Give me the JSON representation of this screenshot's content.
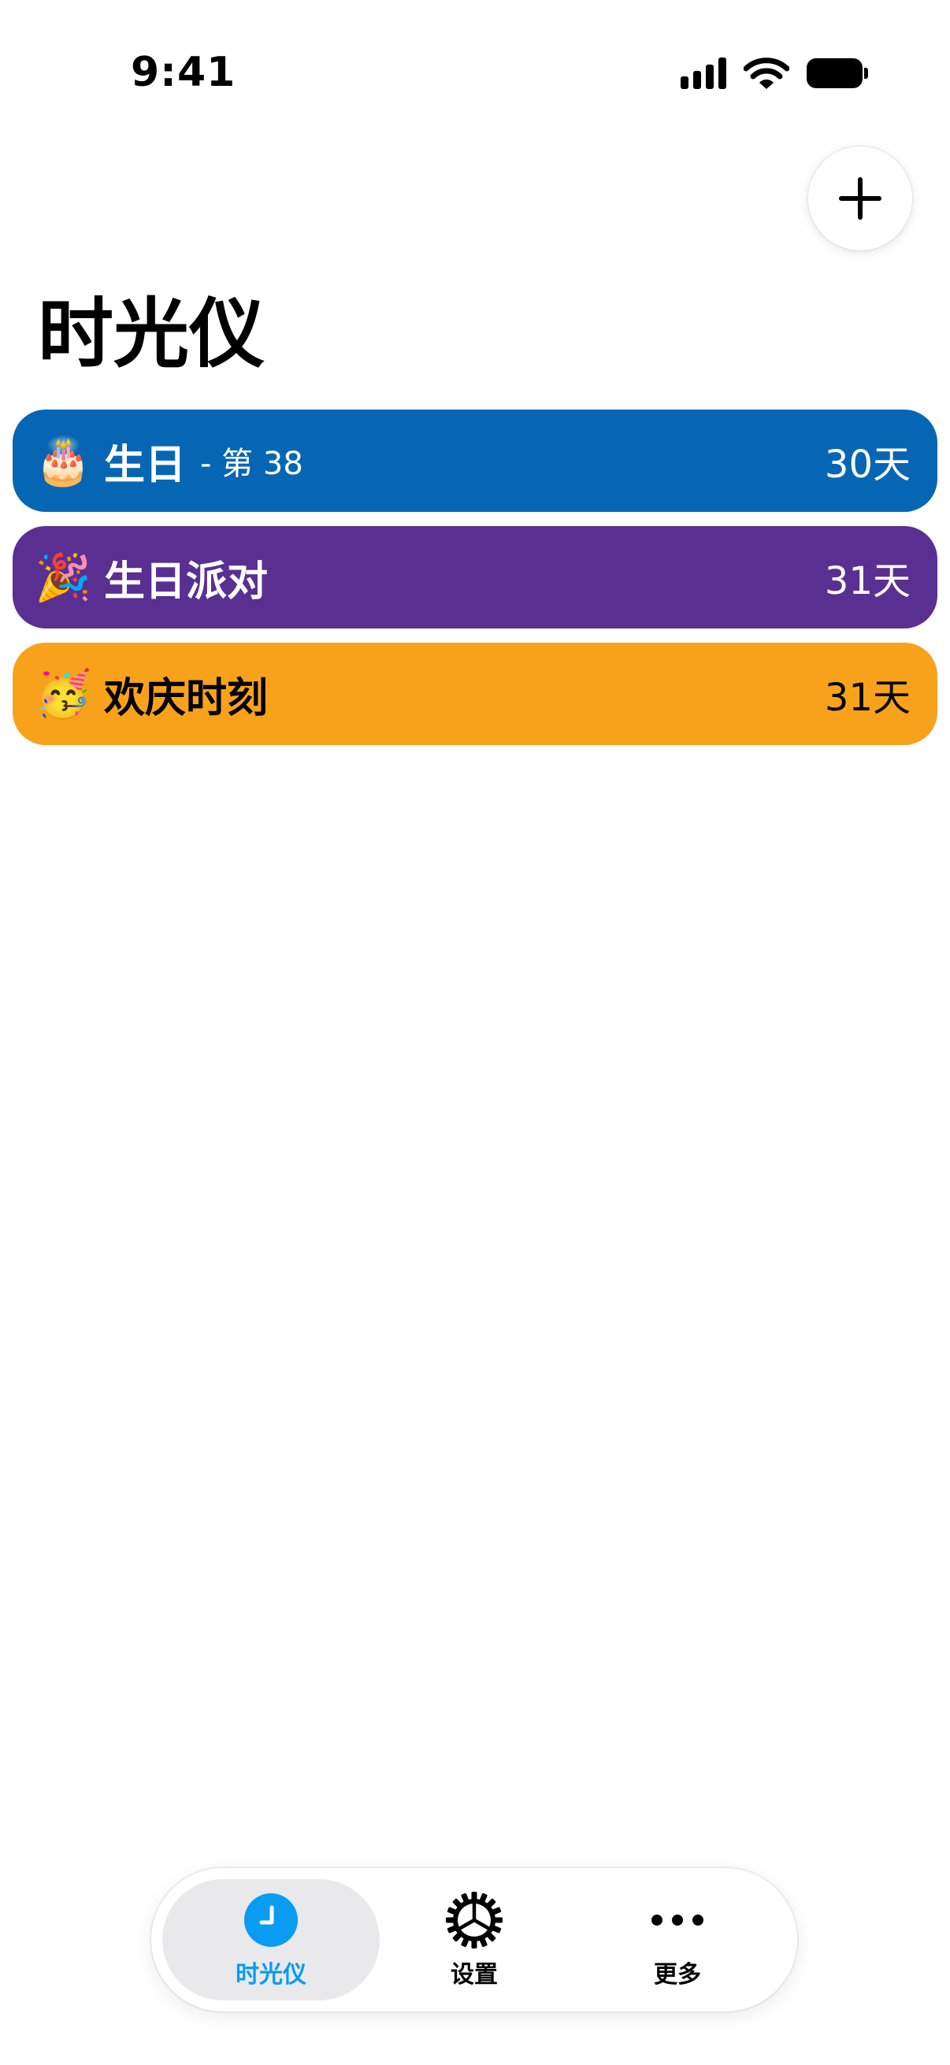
{
  "status_bar": {
    "time": "9:41"
  },
  "header": {
    "title": "时光仪",
    "add_icon": "plus-icon"
  },
  "events": [
    {
      "emoji": "🎂",
      "title": "生日",
      "suffix": "- 第 38",
      "days": "30天",
      "color": "#0766B4",
      "text_color": "#ffffff"
    },
    {
      "emoji": "🎉",
      "title": "生日派对",
      "suffix": "",
      "days": "31天",
      "color": "#5A2F92",
      "text_color": "#ffffff"
    },
    {
      "emoji": "🥳",
      "title": "欢庆时刻",
      "suffix": "",
      "days": "31天",
      "color": "#F8A21C",
      "text_color": "#000000"
    }
  ],
  "tab_bar": {
    "tabs": [
      {
        "label": "时光仪",
        "icon": "clock-icon",
        "active": true,
        "color": "#0A9CF2"
      },
      {
        "label": "设置",
        "icon": "gear-icon",
        "active": false,
        "color": "#000000"
      },
      {
        "label": "更多",
        "icon": "ellipsis-icon",
        "active": false,
        "color": "#000000"
      }
    ]
  }
}
